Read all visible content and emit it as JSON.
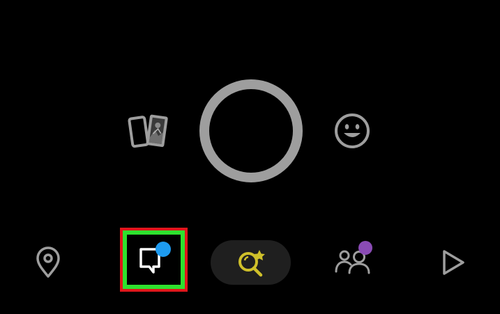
{
  "colors": {
    "background": "#000000",
    "icon_gray": "#9e9e9e",
    "icon_white": "#ffffff",
    "chat_badge": "#1e9bf0",
    "friends_badge": "#8a4bb5",
    "spotlight_yellow": "#cfc02a",
    "pill_bg": "#1f1f1f",
    "highlight_green": "#2ee12e",
    "highlight_red": "#e0161b"
  },
  "camera": {
    "left_icon": "memories-cards-icon",
    "center_icon": "capture-ring",
    "right_icon": "smiley-face-icon"
  },
  "nav": {
    "items": [
      {
        "icon": "map-pin-icon"
      },
      {
        "icon": "chat-bubble-icon",
        "highlighted": true,
        "badge": true
      },
      {
        "icon": "spotlight-search-star-icon"
      },
      {
        "icon": "friends-icon",
        "badge": true
      },
      {
        "icon": "play-triangle-icon"
      }
    ]
  }
}
